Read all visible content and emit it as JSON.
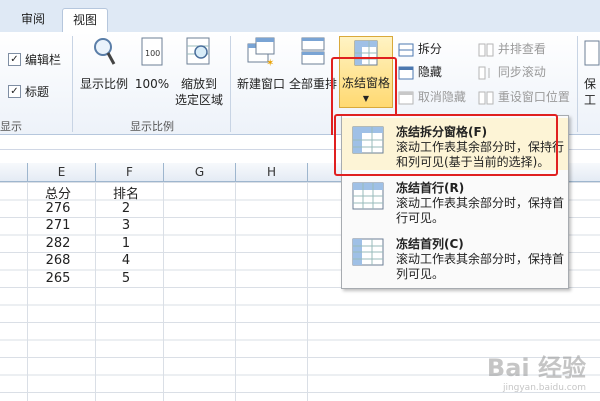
{
  "tabs": [
    {
      "label": "审阅"
    },
    {
      "label": "视图"
    }
  ],
  "show_group": {
    "items": [
      {
        "label": "编辑栏",
        "checked": true
      },
      {
        "label": "标题",
        "checked": true
      }
    ],
    "label": "显示"
  },
  "zoom_group": {
    "buttons": [
      {
        "label": "显示比例"
      },
      {
        "label": "100%"
      },
      {
        "label_line1": "缩放到",
        "label_line2": "选定区域"
      }
    ],
    "label": "显示比例"
  },
  "window_group": {
    "new_window": "新建窗口",
    "arrange_all": "全部重排",
    "freeze_panes": "冻结窗格",
    "split": "拆分",
    "hide": "隐藏",
    "unhide": "取消隐藏",
    "view_side_by_side": "并排查看",
    "sync_scroll": "同步滚动",
    "reset_window": "重设窗口位置",
    "save_cut": "保",
    "workspace_cut": "工"
  },
  "columns": [
    "E",
    "F",
    "G",
    "H"
  ],
  "table": {
    "headers": [
      "总分",
      "排名"
    ],
    "rows": [
      [
        "276",
        "2"
      ],
      [
        "271",
        "3"
      ],
      [
        "282",
        "1"
      ],
      [
        "268",
        "4"
      ],
      [
        "265",
        "5"
      ]
    ]
  },
  "freeze_menu": {
    "items": [
      {
        "title": "冻结拆分窗格(F)",
        "desc": "滚动工作表其余部分时，保持行和列可见(基于当前的选择)。"
      },
      {
        "title": "冻结首行(R)",
        "desc": "滚动工作表其余部分时，保持首行可见。"
      },
      {
        "title": "冻结首列(C)",
        "desc": "滚动工作表其余部分时，保持首列可见。"
      }
    ]
  },
  "watermark": {
    "main": "Bai 经验",
    "sub": "jingyan.baidu.com"
  },
  "colors": {
    "highlight_red": "#e02020",
    "ribbon_blue": "#dfe9f5"
  }
}
